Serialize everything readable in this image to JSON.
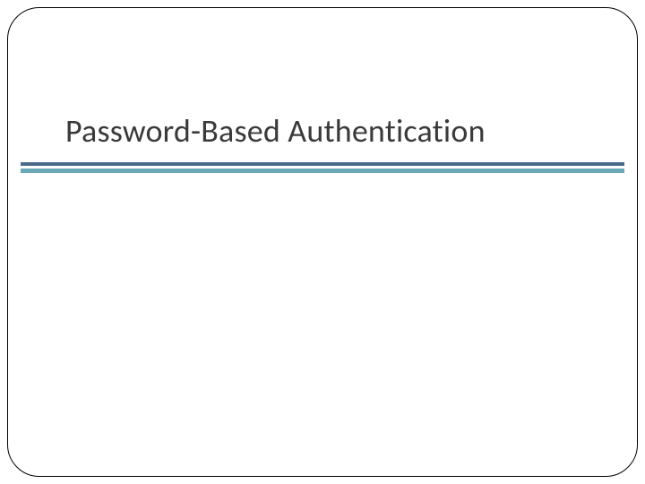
{
  "slide": {
    "title": "Password-Based Authentication"
  },
  "colors": {
    "bar_dark": "#4a6a8a",
    "bar_light": "#6aa8b8",
    "text": "#3a3a3a",
    "border": "#000000"
  }
}
